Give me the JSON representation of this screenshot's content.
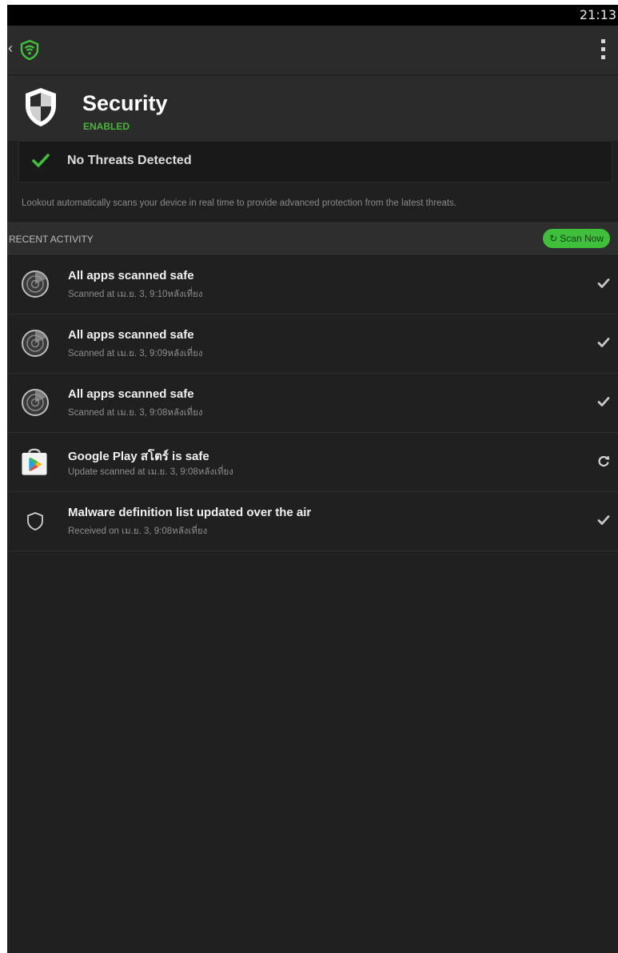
{
  "status_bar": {
    "time": "21:13"
  },
  "action_bar": {
    "back_icon": "chevron-left-icon",
    "logo_icon": "lookout-wifi-shield-icon",
    "menu_icon": "overflow-menu-icon"
  },
  "security": {
    "title": "Security",
    "status": "ENABLED",
    "icon": "shield-icon"
  },
  "threat_status": {
    "label": "No Threats Detected",
    "icon": "check-icon"
  },
  "description": "Lookout automatically scans your device in real time to provide advanced protection from the latest threats.",
  "recent_activity": {
    "header": "RECENT ACTIVITY",
    "scan_button": "Scan Now",
    "items": [
      {
        "title": "All apps scanned safe",
        "subtitle": "Scanned at เม.ย. 3, 9:10หลังเที่ยง",
        "icon": "radar-scan-icon",
        "status": "check-icon"
      },
      {
        "title": "All apps scanned safe",
        "subtitle": "Scanned at เม.ย. 3, 9:09หลังเที่ยง",
        "icon": "radar-scan-icon",
        "status": "check-icon"
      },
      {
        "title": "All apps scanned safe",
        "subtitle": "Scanned at เม.ย. 3, 9:08หลังเที่ยง",
        "icon": "radar-scan-icon",
        "status": "check-icon"
      },
      {
        "title": "Google Play สโตร์ is safe",
        "subtitle": "Update scanned at เม.ย. 3, 9:08หลังเที่ยง",
        "icon": "google-play-store-icon",
        "status": "refresh-icon"
      },
      {
        "title": "Malware definition list updated over the air",
        "subtitle": "Received on เม.ย. 3, 9:08หลังเที่ยง",
        "icon": "shield-outline-icon",
        "status": "check-icon"
      }
    ]
  },
  "colors": {
    "accent_green": "#48b63a",
    "background": "#202020",
    "bar": "#2b2b2b"
  }
}
